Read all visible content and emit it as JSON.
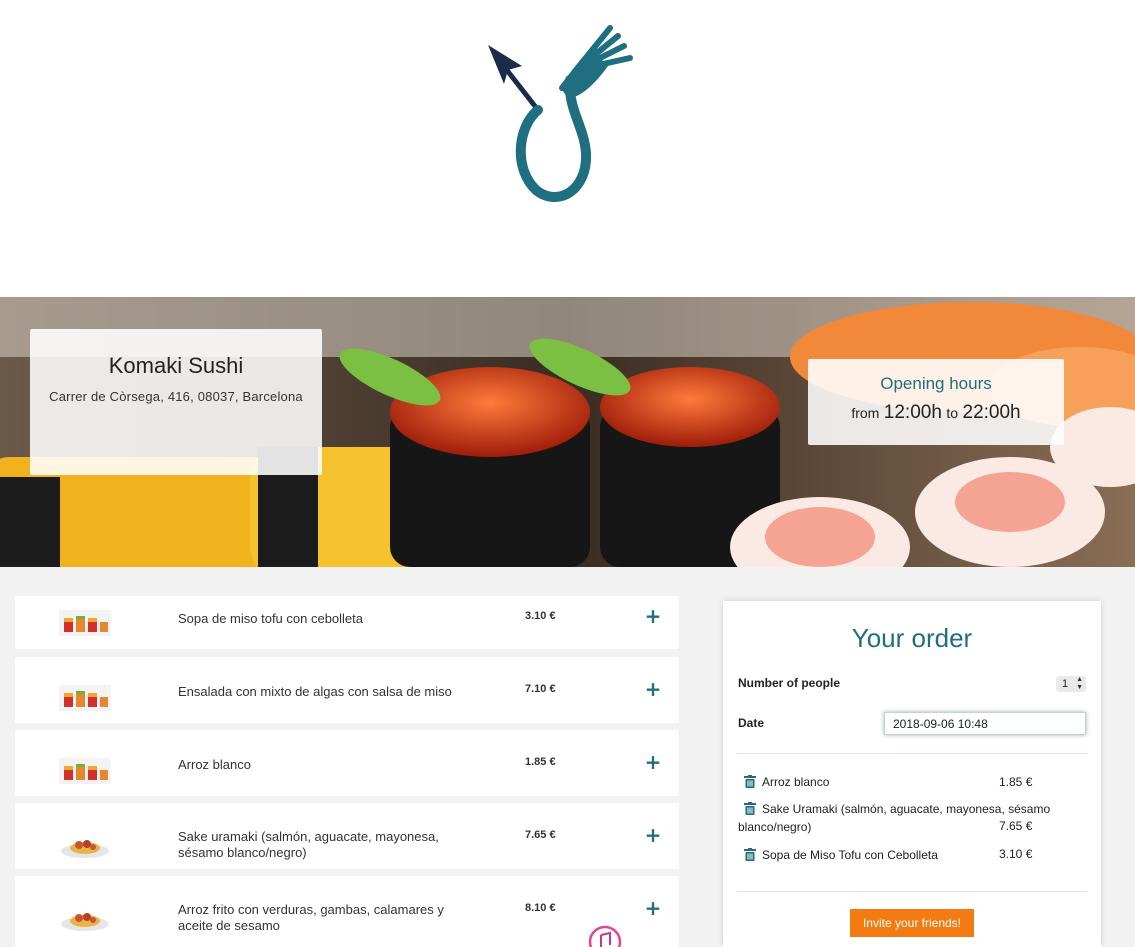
{
  "restaurant": {
    "name": "Komaki Sushi",
    "address": "Carrer de Còrsega, 416, 08037, Barcelona"
  },
  "hours": {
    "title": "Opening hours",
    "from_word": "from",
    "open": "12:00h",
    "to_word": "to",
    "close": "22:00h"
  },
  "menu": {
    "items": [
      {
        "name": "Sopa de miso tofu con cebolleta",
        "price": "3.10 €",
        "add": "+",
        "thumb": "sushi-rolls-icon"
      },
      {
        "name": "Ensalada con mixto de algas con salsa de miso",
        "price": "7.10 €",
        "add": "+",
        "thumb": "sushi-rolls-icon"
      },
      {
        "name": "Arroz blanco",
        "price": "1.85 €",
        "add": "+",
        "thumb": "sushi-rolls-icon"
      },
      {
        "name": "Sake uramaki (salmón, aguacate, mayonesa, sésamo blanco/negro)",
        "price": "7.65 €",
        "add": "+",
        "thumb": "dish-plate-icon"
      },
      {
        "name": "Arroz frito con verduras, gambas, calamares y aceite de sesamo",
        "price": "8.10 €",
        "add": "+",
        "thumb": "dish-plate-icon"
      }
    ]
  },
  "order": {
    "title": "Your order",
    "people_label": "Number of people",
    "people_value": "1",
    "date_label": "Date",
    "date_value": "2018-09-06 10:48",
    "lines": [
      {
        "name": "Arroz blanco",
        "price": "1.85 €"
      },
      {
        "name": "Sake Uramaki (salmón, aguacate, mayonesa, sésamo blanco/negro)",
        "price": "7.65 €"
      },
      {
        "name": "Sopa de Miso Tofu con Cebolleta",
        "price": "3.10 €"
      }
    ],
    "invite_label": "Invite your friends!"
  },
  "colors": {
    "brand": "#1f6f80",
    "logo_arrow": "#1b2b4a",
    "invite": "#f47b12"
  }
}
